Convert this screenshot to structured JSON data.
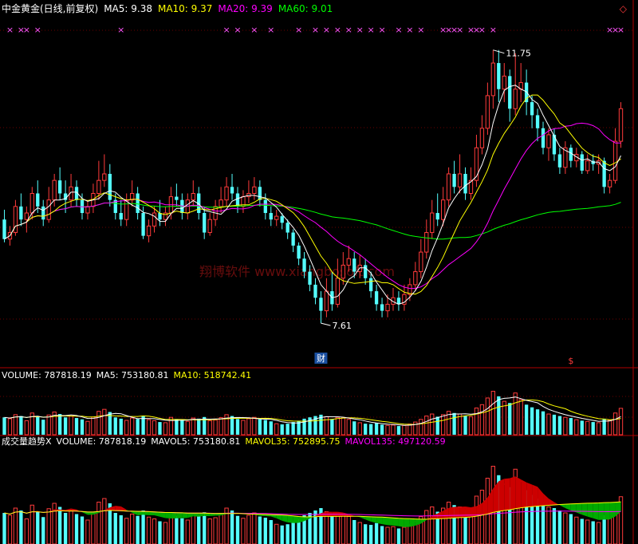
{
  "watermark": "翔博软件 www.xiangbosoft.com",
  "colors": {
    "background": "#000000",
    "up": "#ff3b3b",
    "down": "#54ffff",
    "ma5": "#ffffff",
    "ma10": "#ffff00",
    "ma20": "#ff00ff",
    "ma60": "#00ff00",
    "separator": "#b00000",
    "signal": "#ff55ff",
    "area_up": "#cc0000",
    "area_down": "#00aa00"
  },
  "header": {
    "title": "中金黄金(日线,前复权)",
    "ma5": "MA5: 9.38",
    "ma10": "MA10: 9.37",
    "ma20": "MA20: 9.39",
    "ma60": "MA60: 9.01",
    "diamond": "◇"
  },
  "volume_header": {
    "volume": "VOLUME: 787818.19",
    "ma5": "MA5: 753180.81",
    "ma10": "MA10: 518742.41"
  },
  "indicator_header": {
    "name": "成交量趋势X",
    "volume": "VOLUME: 787818.19",
    "mavol5": "MAVOL5: 753180.81",
    "mavol35": "MAVOL35: 752895.75",
    "mavol135": "MAVOL135: 497120.59"
  },
  "annotations": {
    "high": "11.75",
    "low": "7.61",
    "cai_badge": "财",
    "dollar_badge": "$"
  },
  "chart_data": {
    "type": "candlestick",
    "price_ylim": [
      7.0,
      12.2
    ],
    "volume_ylim": [
      0,
      1600000
    ],
    "indicator_ylim": [
      0,
      1600000
    ],
    "candles": [
      [
        9.2,
        8.9,
        9.35,
        8.85,
        520000
      ],
      [
        8.9,
        9.0,
        9.1,
        8.8,
        480000
      ],
      [
        9.0,
        9.4,
        9.5,
        8.95,
        600000
      ],
      [
        9.4,
        9.2,
        9.6,
        9.1,
        560000
      ],
      [
        9.2,
        9.3,
        9.4,
        9.0,
        420000
      ],
      [
        9.3,
        9.6,
        9.7,
        9.2,
        650000
      ],
      [
        9.6,
        9.4,
        9.8,
        9.3,
        540000
      ],
      [
        9.4,
        9.2,
        9.5,
        9.1,
        450000
      ],
      [
        9.2,
        9.5,
        9.7,
        9.15,
        590000
      ],
      [
        9.5,
        9.8,
        9.9,
        9.4,
        680000
      ],
      [
        9.8,
        9.6,
        10.0,
        9.5,
        620000
      ],
      [
        9.6,
        9.5,
        9.8,
        9.3,
        520000
      ],
      [
        9.5,
        9.7,
        9.9,
        9.4,
        560000
      ],
      [
        9.7,
        9.5,
        9.8,
        9.4,
        500000
      ],
      [
        9.5,
        9.3,
        9.6,
        9.2,
        460000
      ],
      [
        9.3,
        9.4,
        9.5,
        9.2,
        400000
      ],
      [
        9.4,
        9.6,
        9.75,
        9.3,
        530000
      ],
      [
        9.6,
        9.8,
        10.1,
        9.5,
        700000
      ],
      [
        9.8,
        9.9,
        10.2,
        9.7,
        760000
      ],
      [
        9.9,
        9.5,
        10.05,
        9.4,
        680000
      ],
      [
        9.5,
        9.3,
        9.6,
        9.2,
        520000
      ],
      [
        9.3,
        9.2,
        9.5,
        9.1,
        480000
      ],
      [
        9.2,
        9.5,
        9.6,
        9.1,
        430000
      ],
      [
        9.5,
        9.6,
        9.8,
        9.4,
        500000
      ],
      [
        9.6,
        9.3,
        9.7,
        9.2,
        470000
      ],
      [
        9.3,
        8.95,
        9.4,
        8.9,
        560000
      ],
      [
        8.95,
        9.1,
        9.2,
        8.85,
        450000
      ],
      [
        9.1,
        9.3,
        9.4,
        9.0,
        420000
      ],
      [
        9.3,
        9.2,
        9.5,
        9.1,
        380000
      ],
      [
        9.2,
        9.3,
        9.4,
        9.1,
        360000
      ],
      [
        9.3,
        9.55,
        9.7,
        9.2,
        520000
      ],
      [
        9.55,
        9.5,
        9.75,
        9.4,
        470000
      ],
      [
        9.5,
        9.3,
        9.6,
        9.2,
        430000
      ],
      [
        9.3,
        9.5,
        9.6,
        9.2,
        400000
      ],
      [
        9.5,
        9.6,
        9.8,
        9.4,
        500000
      ],
      [
        9.6,
        9.3,
        9.7,
        9.2,
        480000
      ],
      [
        9.3,
        9.0,
        9.4,
        8.9,
        530000
      ],
      [
        9.0,
        9.2,
        9.3,
        8.95,
        420000
      ],
      [
        9.2,
        9.4,
        9.5,
        9.1,
        440000
      ],
      [
        9.4,
        9.5,
        9.7,
        9.3,
        510000
      ],
      [
        9.5,
        9.7,
        9.85,
        9.4,
        600000
      ],
      [
        9.7,
        9.6,
        9.9,
        9.5,
        560000
      ],
      [
        9.6,
        9.4,
        9.7,
        9.3,
        470000
      ],
      [
        9.4,
        9.55,
        9.65,
        9.3,
        430000
      ],
      [
        9.55,
        9.6,
        9.8,
        9.45,
        480000
      ],
      [
        9.6,
        9.7,
        9.85,
        9.5,
        520000
      ],
      [
        9.7,
        9.5,
        9.8,
        9.4,
        460000
      ],
      [
        9.5,
        9.3,
        9.6,
        9.2,
        440000
      ],
      [
        9.3,
        9.2,
        9.4,
        9.1,
        400000
      ],
      [
        9.2,
        9.25,
        9.35,
        9.1,
        330000
      ],
      [
        9.25,
        9.15,
        9.3,
        9.05,
        310000
      ],
      [
        9.15,
        9.0,
        9.2,
        8.9,
        330000
      ],
      [
        9.0,
        8.8,
        9.05,
        8.7,
        380000
      ],
      [
        8.8,
        8.6,
        8.85,
        8.5,
        420000
      ],
      [
        8.6,
        8.4,
        8.7,
        8.3,
        480000
      ],
      [
        8.4,
        8.2,
        8.5,
        8.1,
        520000
      ],
      [
        8.2,
        8.0,
        8.3,
        7.9,
        560000
      ],
      [
        8.0,
        7.8,
        8.1,
        7.61,
        600000
      ],
      [
        7.8,
        8.1,
        8.3,
        7.7,
        540000
      ],
      [
        8.1,
        7.9,
        8.4,
        7.8,
        470000
      ],
      [
        7.9,
        8.3,
        8.6,
        7.85,
        520000
      ],
      [
        8.3,
        8.5,
        8.7,
        8.2,
        500000
      ],
      [
        8.5,
        8.6,
        8.8,
        8.4,
        460000
      ],
      [
        8.6,
        8.4,
        8.7,
        8.3,
        400000
      ],
      [
        8.4,
        8.5,
        8.65,
        8.3,
        360000
      ],
      [
        8.5,
        8.3,
        8.6,
        8.2,
        330000
      ],
      [
        8.3,
        8.1,
        8.4,
        8.0,
        320000
      ],
      [
        8.1,
        7.9,
        8.2,
        7.8,
        350000
      ],
      [
        7.9,
        7.8,
        8.0,
        7.7,
        300000
      ],
      [
        7.8,
        7.9,
        8.05,
        7.7,
        280000
      ],
      [
        7.9,
        8.0,
        8.15,
        7.8,
        290000
      ],
      [
        8.0,
        7.9,
        8.1,
        7.8,
        260000
      ],
      [
        7.9,
        8.05,
        8.2,
        7.8,
        280000
      ],
      [
        8.05,
        8.2,
        8.3,
        7.95,
        320000
      ],
      [
        8.2,
        8.4,
        8.55,
        8.1,
        380000
      ],
      [
        8.4,
        8.7,
        8.9,
        8.3,
        460000
      ],
      [
        8.7,
        9.0,
        9.2,
        8.6,
        560000
      ],
      [
        9.0,
        9.3,
        9.5,
        8.9,
        620000
      ],
      [
        9.3,
        9.2,
        9.6,
        9.1,
        540000
      ],
      [
        9.2,
        9.5,
        9.7,
        9.1,
        600000
      ],
      [
        9.5,
        9.9,
        10.0,
        9.4,
        700000
      ],
      [
        9.9,
        9.7,
        10.1,
        9.6,
        650000
      ],
      [
        9.7,
        9.9,
        10.2,
        9.6,
        620000
      ],
      [
        9.9,
        9.6,
        10.0,
        9.5,
        560000
      ],
      [
        9.6,
        9.8,
        10.0,
        9.5,
        540000
      ],
      [
        9.8,
        10.3,
        10.5,
        9.7,
        800000
      ],
      [
        10.3,
        10.6,
        10.8,
        10.2,
        900000
      ],
      [
        10.6,
        11.1,
        11.3,
        10.5,
        1100000
      ],
      [
        11.1,
        11.6,
        11.8,
        10.9,
        1300000
      ],
      [
        11.6,
        11.2,
        11.8,
        11.0,
        1150000
      ],
      [
        11.2,
        11.4,
        11.6,
        11.0,
        1000000
      ],
      [
        11.4,
        10.9,
        11.5,
        10.7,
        950000
      ],
      [
        10.9,
        11.2,
        11.75,
        10.8,
        1250000
      ],
      [
        11.2,
        11.3,
        11.6,
        11.0,
        1050000
      ],
      [
        11.3,
        11.0,
        11.5,
        10.8,
        900000
      ],
      [
        11.0,
        10.8,
        11.1,
        10.6,
        820000
      ],
      [
        10.8,
        10.6,
        10.9,
        10.4,
        760000
      ],
      [
        10.6,
        10.3,
        10.7,
        10.2,
        700000
      ],
      [
        10.3,
        10.5,
        10.6,
        10.1,
        620000
      ],
      [
        10.5,
        10.2,
        10.6,
        10.1,
        600000
      ],
      [
        10.2,
        10.0,
        10.3,
        9.9,
        560000
      ],
      [
        10.0,
        10.3,
        10.4,
        9.9,
        520000
      ],
      [
        10.3,
        10.1,
        10.35,
        10.0,
        500000
      ],
      [
        10.1,
        10.2,
        10.3,
        10.0,
        450000
      ],
      [
        10.2,
        9.95,
        10.25,
        9.9,
        420000
      ],
      [
        9.95,
        10.1,
        10.2,
        9.9,
        400000
      ],
      [
        10.1,
        10.05,
        10.2,
        9.95,
        380000
      ],
      [
        10.05,
        10.1,
        10.2,
        9.9,
        360000
      ],
      [
        10.1,
        9.7,
        10.15,
        9.6,
        480000
      ],
      [
        9.7,
        9.8,
        9.9,
        9.6,
        430000
      ],
      [
        9.8,
        10.4,
        10.6,
        9.75,
        650000
      ],
      [
        10.4,
        10.9,
        11.0,
        10.3,
        790000
      ]
    ],
    "signal_marks": [
      1,
      3,
      4,
      6,
      21,
      40,
      42,
      45,
      48,
      53,
      56,
      58,
      60,
      62,
      64,
      66,
      68,
      71,
      73,
      75,
      79,
      80,
      81,
      82,
      84,
      85,
      86,
      88,
      109,
      110,
      111
    ]
  }
}
